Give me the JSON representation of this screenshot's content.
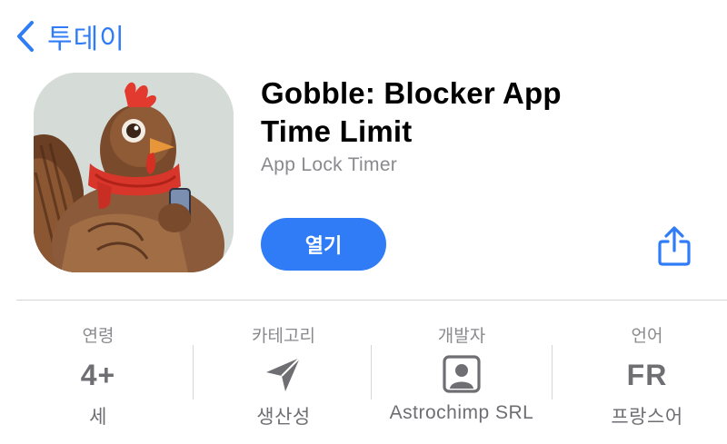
{
  "nav": {
    "back_label": "투데이"
  },
  "app": {
    "title_line1": "Gobble: Blocker App",
    "title_line2": "Time Limit",
    "subtitle": "App Lock Timer",
    "open_label": "열기"
  },
  "info": {
    "age": {
      "label": "연령",
      "value": "4+",
      "sub": "세"
    },
    "category": {
      "label": "카테고리",
      "icon": "paper-plane-icon",
      "sub": "생산성"
    },
    "developer": {
      "label": "개발자",
      "icon": "person-square-icon",
      "sub": "Astrochimp SRL"
    },
    "language": {
      "label": "언어",
      "value": "FR",
      "sub": "프랑스어"
    }
  },
  "colors": {
    "accent": "#2f7cf6",
    "secondary_text": "#8a8a8e",
    "info_text": "#6e6e73"
  }
}
